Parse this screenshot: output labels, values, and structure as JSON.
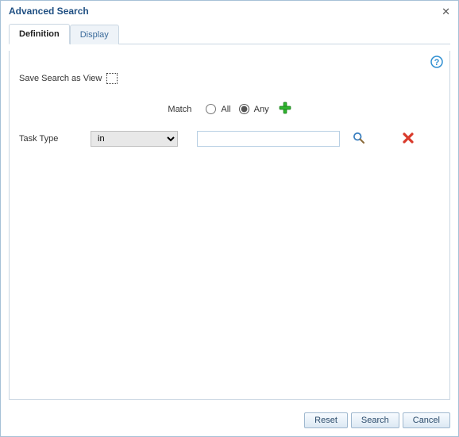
{
  "titlebar": {
    "title": "Advanced Search"
  },
  "tabs": {
    "definition": "Definition",
    "display": "Display"
  },
  "form": {
    "save_as_view_label": "Save Search as View",
    "match_label": "Match",
    "match_all_label": "All",
    "match_any_label": "Any",
    "match_selected": "any",
    "criteria": {
      "field_label": "Task Type",
      "operator": "in",
      "value": ""
    }
  },
  "buttons": {
    "reset": "Reset",
    "search": "Search",
    "cancel": "Cancel"
  }
}
